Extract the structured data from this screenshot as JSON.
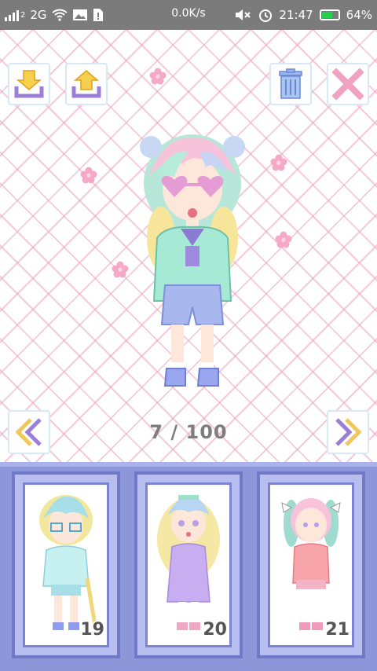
{
  "status_bar": {
    "sim_label": "2",
    "network_type": "2G",
    "speed": "0.0K/s",
    "time": "21:47",
    "battery_percent": "64%",
    "battery_level": 0.64,
    "battery_color": "#22d24b"
  },
  "editor": {
    "counter": "7 / 100",
    "buttons": {
      "save": "download-icon",
      "load": "upload-icon",
      "delete": "trash-icon",
      "close": "close-icon",
      "prev": "double-chevron-left-icon",
      "next": "double-chevron-right-icon"
    }
  },
  "tray": {
    "slots": [
      {
        "number": "19"
      },
      {
        "number": "20"
      },
      {
        "number": "21"
      }
    ]
  },
  "colors": {
    "pattern_pink": "#eba0b9",
    "tray_bg": "#8d96d8",
    "tray_border": "#6f79c6",
    "accent_yellow": "#f5c542",
    "accent_purple": "#9b7fd6"
  }
}
